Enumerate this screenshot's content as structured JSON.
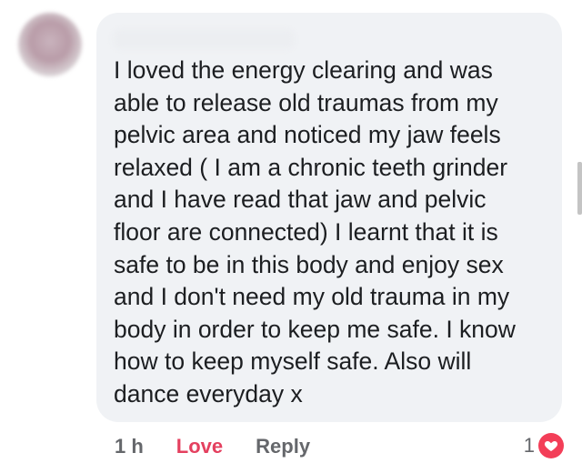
{
  "comment": {
    "author_name": "",
    "text": "I loved the energy clearing and was\nable to release old traumas from my\npelvic area and noticed my jaw feels\nrelaxed ( I am a chronic teeth grinder\nand I have read that jaw and pelvic\nfloor are connected) I learnt that it is\nsafe to be in this body and enjoy sex\nand I don't need my old trauma in my\nbody in order to keep me safe. I know\nhow to keep myself safe. Also will\ndance everyday x"
  },
  "actions": {
    "timestamp": "1 h",
    "love_label": "Love",
    "reply_label": "Reply"
  },
  "reactions": {
    "count": "1",
    "icon": "heart-icon"
  },
  "colors": {
    "love": "#e4405f",
    "heart_badge": "#f33e58",
    "bubble": "#f0f2f5",
    "muted_text": "#65676b",
    "body_text": "#1c1e21"
  }
}
